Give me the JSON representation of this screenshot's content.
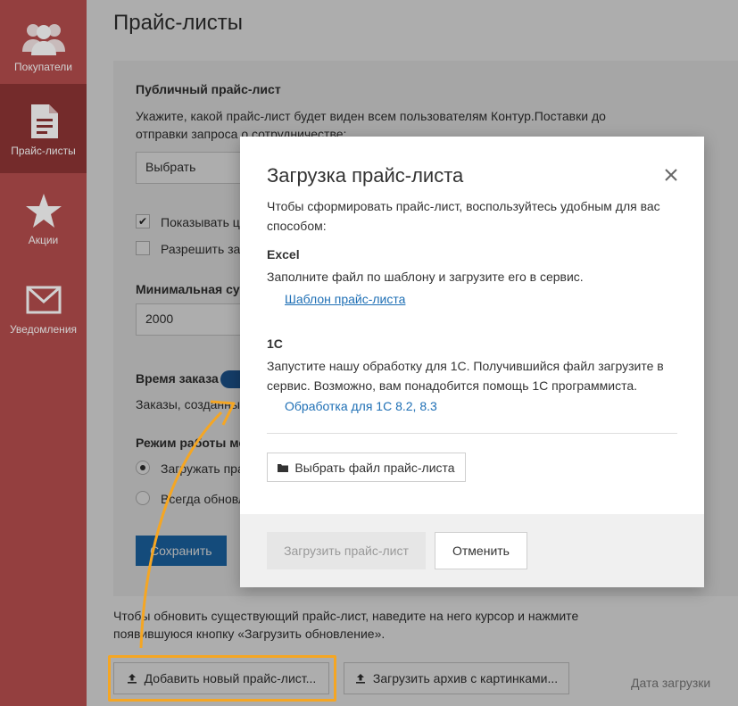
{
  "sidebar": {
    "items": [
      {
        "label": "Покупатели",
        "icon": "users-icon"
      },
      {
        "label": "Прайс-листы",
        "icon": "document-icon",
        "active": true
      },
      {
        "label": "Акции",
        "icon": "star-icon"
      },
      {
        "label": "Уведомления",
        "icon": "envelope-icon"
      }
    ]
  },
  "page": {
    "title": "Прайс-листы",
    "public_heading": "Публичный прайс-лист",
    "public_desc": "Укажите, какой прайс-лист будет виден всем пользователям Контур.Поставки до отправки запроса о сотрудничестве:",
    "select_value": "Выбрать",
    "checkbox_show": "Показывать ц",
    "checkbox_allow": "Разрешить зак",
    "min_sum_label": "Минимальная сум",
    "min_sum_value": "2000",
    "order_time_label": "Время заказа",
    "order_time_desc": "Заказы, созданные",
    "mode_label": "Режим работы мо",
    "radio_1": "Загружать пра",
    "radio_2": "Всегда обновл",
    "save_label": "Сохранить",
    "bottom_text": "Чтобы обновить существующий прайс-лист, наведите на него курсор и нажмите появившуюся кнопку «Загрузить обновление».",
    "add_button": "Добавить новый прайс-лист...",
    "archive_button": "Загрузить архив с картинками...",
    "date_column": "Дата загрузки"
  },
  "modal": {
    "title": "Загрузка прайс-листа",
    "intro": "Чтобы сформировать прайс-лист, воспользуйтесь удобным для вас способом:",
    "excel_heading": "Excel",
    "excel_desc": "Заполните файл по шаблону и загрузите его в сервис.",
    "excel_link": "Шаблон прайс-листа",
    "c1_heading": "1С",
    "c1_desc": "Запустите нашу обработку для 1С. Получившийся файл загрузите в сервис. Возможно, вам понадобится помощь 1С программиста.",
    "c1_link": "Обработка для 1С 8.2, 8.3",
    "select_file": "Выбрать файл прайс-листа",
    "upload_button": "Загрузить прайс-лист",
    "cancel_button": "Отменить"
  },
  "colors": {
    "sidebar": "#b54d4d",
    "sidebar_active": "#8e3535",
    "accent": "#1e6fb5",
    "highlight": "#f5a623"
  }
}
